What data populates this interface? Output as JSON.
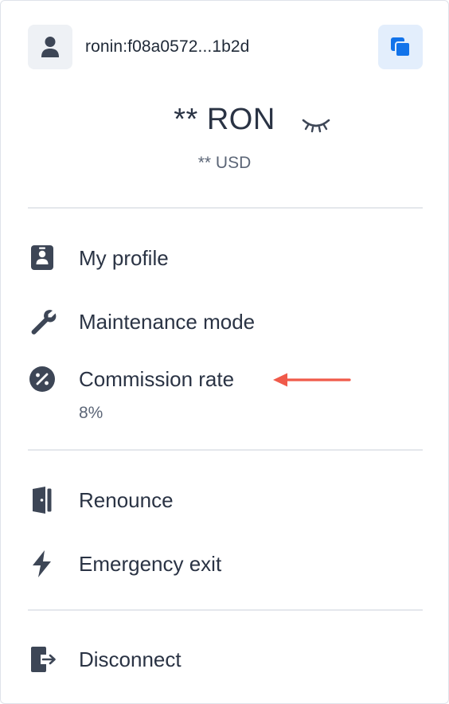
{
  "account": {
    "address": "ronin:f08a0572...1b2d",
    "avatar_icon": "user-icon",
    "copy_icon": "copy-icon"
  },
  "balance": {
    "main": "** RON",
    "secondary": "** USD",
    "visibility_icon": "eye-closed-icon"
  },
  "menu": {
    "items": [
      {
        "label": "My profile",
        "icon": "profile-badge-icon"
      },
      {
        "label": "Maintenance mode",
        "icon": "wrench-icon"
      },
      {
        "label": "Commission rate",
        "icon": "percent-icon",
        "value": "8%"
      },
      {
        "label": "Renounce",
        "icon": "door-icon"
      },
      {
        "label": "Emergency exit",
        "icon": "lightning-icon"
      },
      {
        "label": "Disconnect",
        "icon": "sign-out-icon"
      }
    ]
  },
  "colors": {
    "text_primary": "#2a3344",
    "text_secondary": "#5c6677",
    "accent": "#1273ea",
    "icon": "#3d4656",
    "annotation_arrow": "#f05a4a"
  }
}
